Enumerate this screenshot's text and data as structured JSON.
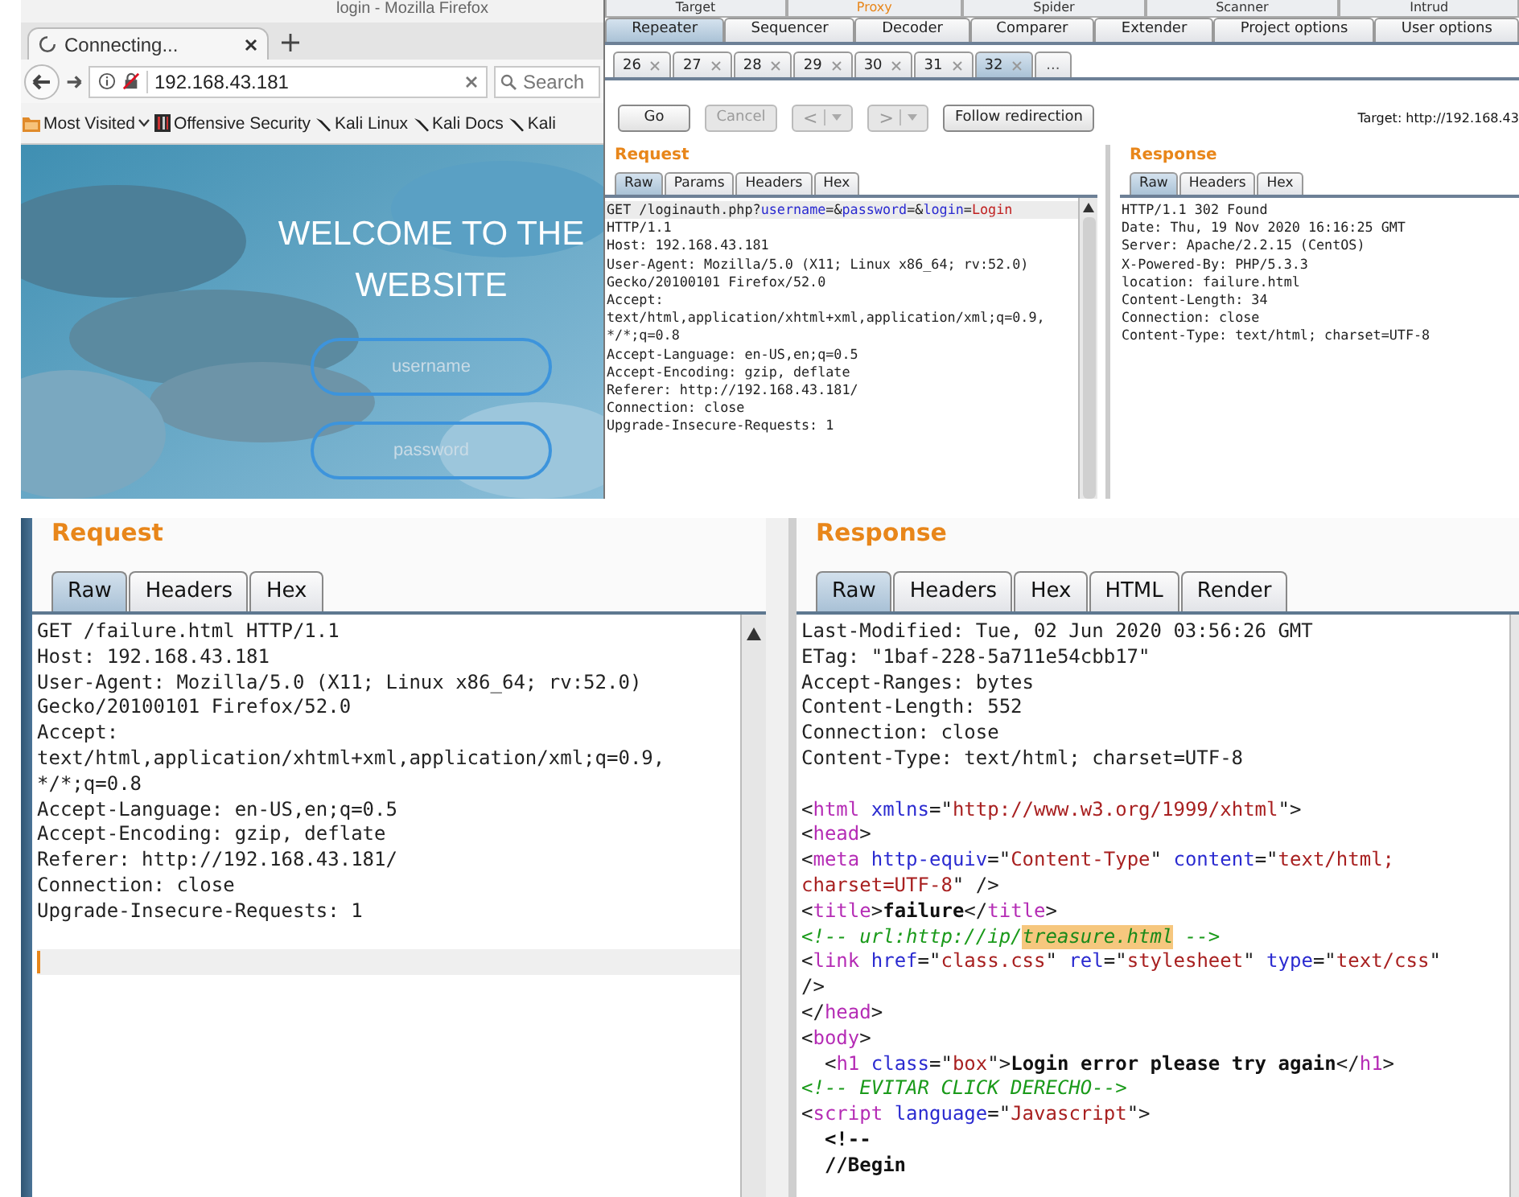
{
  "browser": {
    "window_title": "login - Mozilla Firefox",
    "tab": {
      "title": "Connecting..."
    },
    "url": "192.168.43.181",
    "search": {
      "placeholder": "Search"
    },
    "bookmarks": [
      {
        "label": "Most Visited",
        "kind": "folder"
      },
      {
        "label": "Offensive Security",
        "kind": "site"
      },
      {
        "label": "Kali Linux",
        "kind": "kali"
      },
      {
        "label": "Kali Docs",
        "kind": "kali"
      },
      {
        "label": "Kali",
        "kind": "kali"
      }
    ],
    "page": {
      "heading": "WELCOME TO THE WEBSITE",
      "fields": [
        {
          "placeholder": "username"
        },
        {
          "placeholder": "password"
        }
      ]
    }
  },
  "burp": {
    "tool_tabs": [
      {
        "label": "Target",
        "highlighted": false
      },
      {
        "label": "Proxy",
        "highlighted": true
      },
      {
        "label": "Spider",
        "highlighted": false
      },
      {
        "label": "Scanner",
        "highlighted": false
      },
      {
        "label": "Intrud",
        "highlighted": false
      }
    ],
    "section_tabs": [
      {
        "label": "Repeater",
        "selected": true
      },
      {
        "label": "Sequencer",
        "selected": false
      },
      {
        "label": "Decoder",
        "selected": false
      },
      {
        "label": "Comparer",
        "selected": false
      },
      {
        "label": "Extender",
        "selected": false
      },
      {
        "label": "Project options",
        "selected": false
      },
      {
        "label": "User options",
        "selected": false
      }
    ],
    "repeater_tabs": [
      {
        "label": "26",
        "selected": false
      },
      {
        "label": "27",
        "selected": false
      },
      {
        "label": "28",
        "selected": false
      },
      {
        "label": "29",
        "selected": false
      },
      {
        "label": "30",
        "selected": false
      },
      {
        "label": "31",
        "selected": false
      },
      {
        "label": "32",
        "selected": true
      }
    ],
    "more_tabs": "...",
    "buttons": [
      {
        "label": "Go",
        "kind": "action",
        "disabled": false
      },
      {
        "label": "Cancel",
        "kind": "action",
        "disabled": true
      },
      {
        "label": "<",
        "kind": "history",
        "disabled": true
      },
      {
        "label": ">",
        "kind": "history",
        "disabled": true
      },
      {
        "label": "Follow redirection",
        "kind": "action",
        "disabled": false
      }
    ],
    "target": "Target: http://192.168.43",
    "request": {
      "title": "Request",
      "tabs": [
        {
          "label": "Raw",
          "selected": true
        },
        {
          "label": "Params",
          "selected": false
        },
        {
          "label": "Headers",
          "selected": false
        },
        {
          "label": "Hex",
          "selected": false
        }
      ],
      "lines": [
        {
          "current": true,
          "tokens": [
            {
              "text": "GET /loginauth.php?",
              "kind": "plain"
            },
            {
              "text": "username",
              "kind": "param"
            },
            {
              "text": "=&",
              "kind": "plain"
            },
            {
              "text": "password",
              "kind": "param"
            },
            {
              "text": "=&",
              "kind": "plain"
            },
            {
              "text": "login",
              "kind": "param"
            },
            {
              "text": "=",
              "kind": "plain"
            },
            {
              "text": "Login",
              "kind": "value"
            }
          ]
        },
        {
          "current": false,
          "tokens": [
            {
              "text": "HTTP/1.1",
              "kind": "plain"
            }
          ]
        },
        {
          "current": false,
          "tokens": [
            {
              "text": "Host: 192.168.43.181",
              "kind": "plain"
            }
          ]
        },
        {
          "current": false,
          "tokens": [
            {
              "text": "User-Agent: Mozilla/5.0 (X11; Linux x86_64; rv:52.0)",
              "kind": "plain"
            }
          ]
        },
        {
          "current": false,
          "tokens": [
            {
              "text": "Gecko/20100101 Firefox/52.0",
              "kind": "plain"
            }
          ]
        },
        {
          "current": false,
          "tokens": [
            {
              "text": "Accept:",
              "kind": "plain"
            }
          ]
        },
        {
          "current": false,
          "tokens": [
            {
              "text": "text/html,application/xhtml+xml,application/xml;q=0.9,",
              "kind": "plain"
            }
          ]
        },
        {
          "current": false,
          "tokens": [
            {
              "text": "*/*;q=0.8",
              "kind": "plain"
            }
          ]
        },
        {
          "current": false,
          "tokens": [
            {
              "text": "Accept-Language: en-US,en;q=0.5",
              "kind": "plain"
            }
          ]
        },
        {
          "current": false,
          "tokens": [
            {
              "text": "Accept-Encoding: gzip, deflate",
              "kind": "plain"
            }
          ]
        },
        {
          "current": false,
          "tokens": [
            {
              "text": "Referer: http://192.168.43.181/",
              "kind": "plain"
            }
          ]
        },
        {
          "current": false,
          "tokens": [
            {
              "text": "Connection: close",
              "kind": "plain"
            }
          ]
        },
        {
          "current": false,
          "tokens": [
            {
              "text": "Upgrade-Insecure-Requests: 1",
              "kind": "plain"
            }
          ]
        }
      ]
    },
    "response": {
      "title": "Response",
      "tabs": [
        {
          "label": "Raw",
          "selected": true
        },
        {
          "label": "Headers",
          "selected": false
        },
        {
          "label": "Hex",
          "selected": false
        }
      ],
      "lines": [
        {
          "current": false,
          "tokens": [
            {
              "text": "HTTP/1.1 302 Found",
              "kind": "plain"
            }
          ]
        },
        {
          "current": false,
          "tokens": [
            {
              "text": "Date: Thu, 19 Nov 2020 16:16:25 GMT",
              "kind": "plain"
            }
          ]
        },
        {
          "current": false,
          "tokens": [
            {
              "text": "Server: Apache/2.2.15 (CentOS)",
              "kind": "plain"
            }
          ]
        },
        {
          "current": false,
          "tokens": [
            {
              "text": "X-Powered-By: PHP/5.3.3",
              "kind": "plain"
            }
          ]
        },
        {
          "current": false,
          "tokens": [
            {
              "text": "location: failure.html",
              "kind": "plain"
            }
          ]
        },
        {
          "current": false,
          "tokens": [
            {
              "text": "Content-Length: 34",
              "kind": "plain"
            }
          ]
        },
        {
          "current": false,
          "tokens": [
            {
              "text": "Connection: close",
              "kind": "plain"
            }
          ]
        },
        {
          "current": false,
          "tokens": [
            {
              "text": "Content-Type: text/html; charset=UTF-8",
              "kind": "plain"
            }
          ]
        }
      ]
    }
  },
  "bottom": {
    "request": {
      "title": "Request",
      "tabs": [
        {
          "label": "Raw",
          "selected": true
        },
        {
          "label": "Headers",
          "selected": false
        },
        {
          "label": "Hex",
          "selected": false
        }
      ],
      "lines": [
        {
          "current": false,
          "tokens": [
            {
              "text": "GET /failure.html HTTP/1.1",
              "kind": "plain"
            }
          ]
        },
        {
          "current": false,
          "tokens": [
            {
              "text": "Host: 192.168.43.181",
              "kind": "plain"
            }
          ]
        },
        {
          "current": false,
          "tokens": [
            {
              "text": "User-Agent: Mozilla/5.0 (X11; Linux x86_64; rv:52.0)",
              "kind": "plain"
            }
          ]
        },
        {
          "current": false,
          "tokens": [
            {
              "text": "Gecko/20100101 Firefox/52.0",
              "kind": "plain"
            }
          ]
        },
        {
          "current": false,
          "tokens": [
            {
              "text": "Accept:",
              "kind": "plain"
            }
          ]
        },
        {
          "current": false,
          "tokens": [
            {
              "text": "text/html,application/xhtml+xml,application/xml;q=0.9,",
              "kind": "plain"
            }
          ]
        },
        {
          "current": false,
          "tokens": [
            {
              "text": "*/*;q=0.8",
              "kind": "plain"
            }
          ]
        },
        {
          "current": false,
          "tokens": [
            {
              "text": "Accept-Language: en-US,en;q=0.5",
              "kind": "plain"
            }
          ]
        },
        {
          "current": false,
          "tokens": [
            {
              "text": "Accept-Encoding: gzip, deflate",
              "kind": "plain"
            }
          ]
        },
        {
          "current": false,
          "tokens": [
            {
              "text": "Referer: http://192.168.43.181/",
              "kind": "plain"
            }
          ]
        },
        {
          "current": false,
          "tokens": [
            {
              "text": "Connection: close",
              "kind": "plain"
            }
          ]
        },
        {
          "current": false,
          "tokens": [
            {
              "text": "Upgrade-Insecure-Requests: 1",
              "kind": "plain"
            }
          ]
        },
        {
          "current": false
        },
        {
          "current": true
        }
      ]
    },
    "response": {
      "title": "Response",
      "tabs": [
        {
          "label": "Raw",
          "selected": true
        },
        {
          "label": "Headers",
          "selected": false
        },
        {
          "label": "Hex",
          "selected": false
        },
        {
          "label": "HTML",
          "selected": false
        },
        {
          "label": "Render",
          "selected": false
        }
      ],
      "lines": [
        {
          "current": false,
          "tokens": [
            {
              "text": "Last-Modified: Tue, 02 Jun 2020 03:56:26 GMT",
              "kind": "plain"
            }
          ]
        },
        {
          "current": false,
          "tokens": [
            {
              "text": "ETag: \"1baf-228-5a711e54cbb17\"",
              "kind": "plain"
            }
          ]
        },
        {
          "current": false,
          "tokens": [
            {
              "text": "Accept-Ranges: bytes",
              "kind": "plain"
            }
          ]
        },
        {
          "current": false,
          "tokens": [
            {
              "text": "Content-Length: 552",
              "kind": "plain"
            }
          ]
        },
        {
          "current": false,
          "tokens": [
            {
              "text": "Connection: close",
              "kind": "plain"
            }
          ]
        },
        {
          "current": false,
          "tokens": [
            {
              "text": "Content-Type: text/html; charset=UTF-8",
              "kind": "plain"
            }
          ]
        },
        {
          "current": false
        },
        {
          "current": false,
          "tokens": [
            {
              "text": "<",
              "kind": "plain"
            },
            {
              "text": "html",
              "kind": "tag"
            },
            {
              "text": " xmlns",
              "kind": "attr"
            },
            {
              "text": "=\"",
              "kind": "plain"
            },
            {
              "text": "http://www.w3.org/1999/xhtml",
              "kind": "string"
            },
            {
              "text": "\">",
              "kind": "plain"
            }
          ]
        },
        {
          "current": false,
          "tokens": [
            {
              "text": "<",
              "kind": "plain"
            },
            {
              "text": "head",
              "kind": "tag"
            },
            {
              "text": ">",
              "kind": "plain"
            }
          ]
        },
        {
          "current": false,
          "tokens": [
            {
              "text": "<",
              "kind": "plain"
            },
            {
              "text": "meta",
              "kind": "tag"
            },
            {
              "text": " http-equiv",
              "kind": "attr"
            },
            {
              "text": "=\"",
              "kind": "plain"
            },
            {
              "text": "Content-Type",
              "kind": "string"
            },
            {
              "text": "\" ",
              "kind": "plain"
            },
            {
              "text": "content",
              "kind": "attr"
            },
            {
              "text": "=\"",
              "kind": "plain"
            },
            {
              "text": "text/html;",
              "kind": "string"
            }
          ]
        },
        {
          "current": false,
          "tokens": [
            {
              "text": "charset=UTF-8",
              "kind": "string"
            },
            {
              "text": "\" />",
              "kind": "plain"
            }
          ]
        },
        {
          "current": false,
          "tokens": [
            {
              "text": "<",
              "kind": "plain"
            },
            {
              "text": "title",
              "kind": "tag"
            },
            {
              "text": ">",
              "kind": "plain"
            },
            {
              "text": "failure",
              "kind": "bold"
            },
            {
              "text": "</",
              "kind": "plain"
            },
            {
              "text": "title",
              "kind": "tag"
            },
            {
              "text": ">",
              "kind": "plain"
            }
          ]
        },
        {
          "current": false,
          "tokens": [
            {
              "text": "<!-- url:http://ip/",
              "kind": "comment"
            },
            {
              "text": "treasure.html",
              "kind": "highlight"
            },
            {
              "text": " -->",
              "kind": "comment"
            }
          ]
        },
        {
          "current": false,
          "tokens": [
            {
              "text": "<",
              "kind": "plain"
            },
            {
              "text": "link",
              "kind": "tag"
            },
            {
              "text": " href",
              "kind": "attr"
            },
            {
              "text": "=\"",
              "kind": "plain"
            },
            {
              "text": "class.css",
              "kind": "string"
            },
            {
              "text": "\" ",
              "kind": "plain"
            },
            {
              "text": "rel",
              "kind": "attr"
            },
            {
              "text": "=\"",
              "kind": "plain"
            },
            {
              "text": "stylesheet",
              "kind": "string"
            },
            {
              "text": "\" ",
              "kind": "plain"
            },
            {
              "text": "type",
              "kind": "attr"
            },
            {
              "text": "=\"",
              "kind": "plain"
            },
            {
              "text": "text/css",
              "kind": "string"
            },
            {
              "text": "\"",
              "kind": "plain"
            }
          ]
        },
        {
          "current": false,
          "tokens": [
            {
              "text": "/>",
              "kind": "plain"
            }
          ]
        },
        {
          "current": false,
          "tokens": [
            {
              "text": "</",
              "kind": "plain"
            },
            {
              "text": "head",
              "kind": "tag"
            },
            {
              "text": ">",
              "kind": "plain"
            }
          ]
        },
        {
          "current": false,
          "tokens": [
            {
              "text": "<",
              "kind": "plain"
            },
            {
              "text": "body",
              "kind": "tag"
            },
            {
              "text": ">",
              "kind": "plain"
            }
          ]
        },
        {
          "current": false,
          "tokens": [
            {
              "text": "  <",
              "kind": "plain"
            },
            {
              "text": "h1",
              "kind": "tag"
            },
            {
              "text": " class",
              "kind": "attr"
            },
            {
              "text": "=\"",
              "kind": "plain"
            },
            {
              "text": "box",
              "kind": "string"
            },
            {
              "text": "\">",
              "kind": "plain"
            },
            {
              "text": "Login error please try again",
              "kind": "bold"
            },
            {
              "text": "</",
              "kind": "plain"
            },
            {
              "text": "h1",
              "kind": "tag"
            },
            {
              "text": ">",
              "kind": "plain"
            }
          ]
        },
        {
          "current": false,
          "tokens": [
            {
              "text": "<!-- EVITAR CLICK DERECHO-->",
              "kind": "comment"
            }
          ]
        },
        {
          "current": false,
          "tokens": [
            {
              "text": "<",
              "kind": "plain"
            },
            {
              "text": "script",
              "kind": "tag"
            },
            {
              "text": " language",
              "kind": "attr"
            },
            {
              "text": "=\"",
              "kind": "plain"
            },
            {
              "text": "Javascript",
              "kind": "string"
            },
            {
              "text": "\">",
              "kind": "plain"
            }
          ]
        },
        {
          "current": false,
          "tokens": [
            {
              "text": "  <!--",
              "kind": "bold"
            }
          ]
        },
        {
          "current": false,
          "tokens": [
            {
              "text": "  //Begin",
              "kind": "bold"
            }
          ]
        }
      ]
    }
  }
}
